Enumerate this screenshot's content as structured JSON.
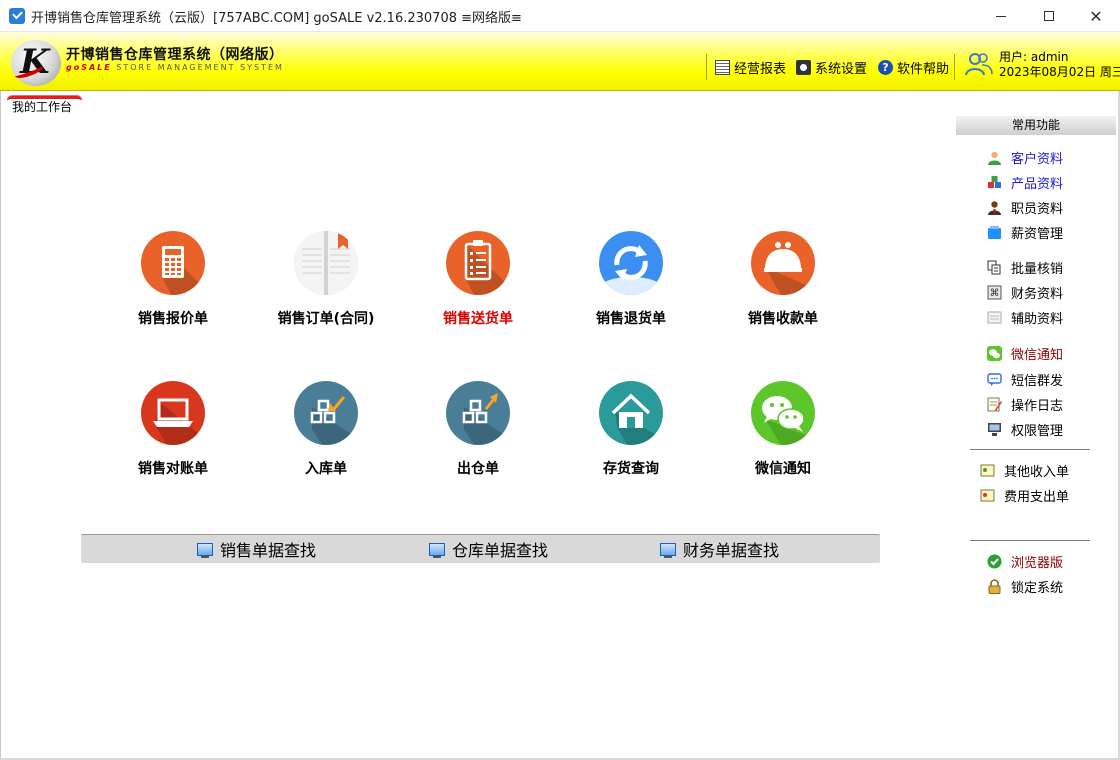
{
  "window": {
    "title": "开博销售仓库管理系统（云版）[757ABC.COM]  goSALE v2.16.230708   ≡网络版≡"
  },
  "header": {
    "brand_title": "开博销售仓库管理系统（网络版）",
    "brand_sub_prefix": "goSALE",
    "brand_sub_rest": " STORE MANAGEMENT SYSTEM",
    "logo_letter": "K",
    "tools": [
      {
        "label": "经营报表",
        "icon": "report-icon"
      },
      {
        "label": "系统设置",
        "icon": "settings-icon"
      },
      {
        "label": "软件帮助",
        "icon": "help-icon"
      }
    ],
    "user_line": "用户: admin",
    "date_line": "2023年08月02日 周三"
  },
  "tab": {
    "label": "我的工作台"
  },
  "tiles": [
    {
      "label": "销售报价单",
      "icon": "calculator-icon",
      "color": "#e8622a"
    },
    {
      "label": "销售订单(合同)",
      "icon": "notebook-icon",
      "color": "#eeeeee"
    },
    {
      "label": "销售送货单",
      "icon": "clipboard-icon",
      "color": "#e8622a",
      "highlight": true
    },
    {
      "label": "销售退货单",
      "icon": "refresh-icon",
      "color": "#3b8ff0"
    },
    {
      "label": "销售收款单",
      "icon": "purse-icon",
      "color": "#e8622a"
    },
    {
      "label": "销售对账单",
      "icon": "laptop-icon",
      "color": "#d9361e"
    },
    {
      "label": "入库单",
      "icon": "boxes-in-icon",
      "color": "#4a7d96"
    },
    {
      "label": "出仓单",
      "icon": "boxes-out-icon",
      "color": "#4a7d96"
    },
    {
      "label": "存货查询",
      "icon": "home-icon",
      "color": "#2a9a9a"
    },
    {
      "label": "微信通知",
      "icon": "wechat-icon",
      "color": "#5cc62a"
    }
  ],
  "search": [
    {
      "label": "销售单据查找"
    },
    {
      "label": "仓库单据查找"
    },
    {
      "label": "财务单据查找"
    }
  ],
  "right_panel": {
    "title": "常用功能",
    "items": [
      {
        "label": "客户资料",
        "icon": "customer-icon"
      },
      {
        "label": "产品资料",
        "icon": "product-icon"
      },
      {
        "label": "职员资料",
        "icon": "staff-icon"
      },
      {
        "label": "薪资管理",
        "icon": "salary-icon"
      },
      {
        "label": "批量核销",
        "icon": "batch-icon"
      },
      {
        "label": "财务资料",
        "icon": "finance-icon"
      },
      {
        "label": "辅助资料",
        "icon": "aux-icon"
      },
      {
        "label": "微信通知",
        "icon": "wechat-small-icon"
      },
      {
        "label": "短信群发",
        "icon": "sms-icon"
      },
      {
        "label": "操作日志",
        "icon": "log-icon"
      },
      {
        "label": "权限管理",
        "icon": "permission-icon"
      },
      {
        "label": "其他收入单",
        "icon": "income-icon"
      },
      {
        "label": "费用支出单",
        "icon": "expense-icon"
      },
      {
        "label": "浏览器版",
        "icon": "browser-check-icon"
      },
      {
        "label": "锁定系统",
        "icon": "lock-icon"
      }
    ]
  }
}
